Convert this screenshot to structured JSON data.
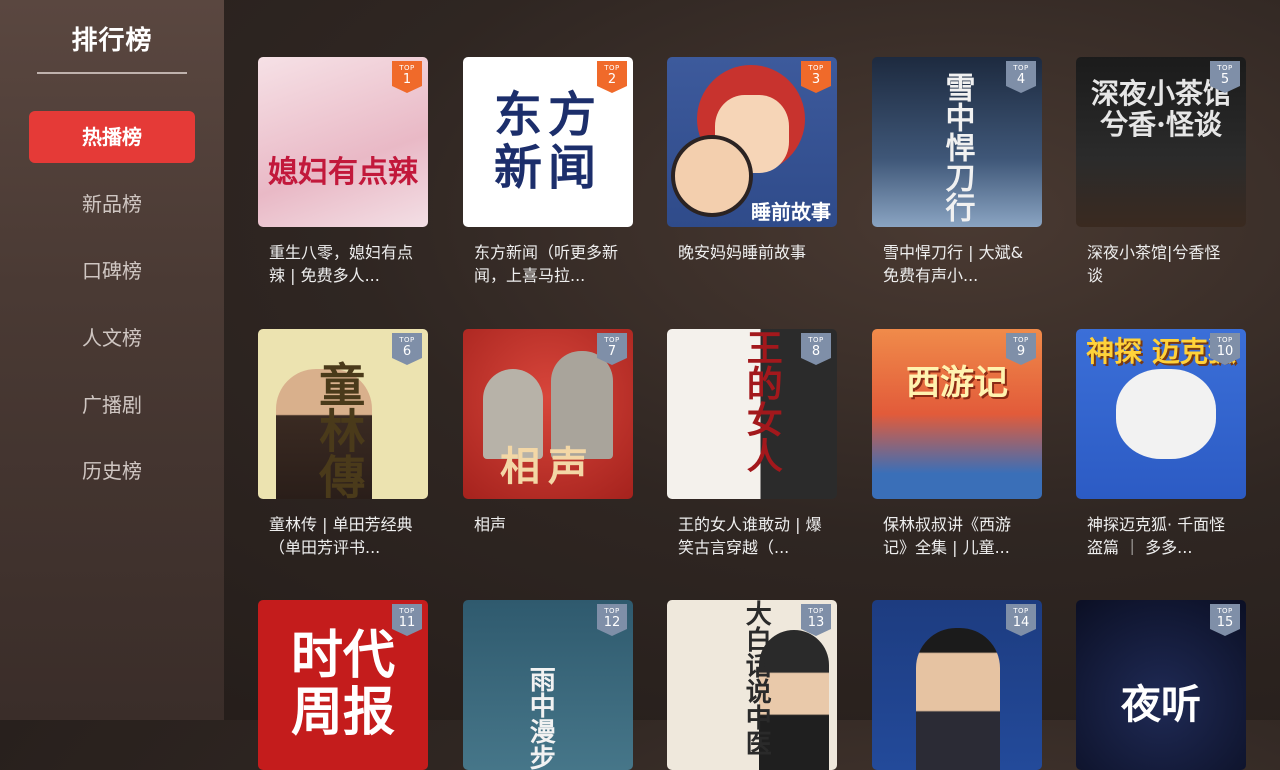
{
  "sidebar": {
    "title": "排行榜",
    "items": [
      {
        "label": "热播榜",
        "active": true
      },
      {
        "label": "新品榜",
        "active": false
      },
      {
        "label": "口碑榜",
        "active": false
      },
      {
        "label": "人文榜",
        "active": false
      },
      {
        "label": "广播剧",
        "active": false
      },
      {
        "label": "历史榜",
        "active": false
      }
    ]
  },
  "badge_label": "TOP",
  "accent_color": "#e53a37",
  "cards": [
    {
      "rank": "1",
      "title": "重生八零，媳妇有点辣 | 免费多人...",
      "cover_text": "媳妇有点辣"
    },
    {
      "rank": "2",
      "title": "东方新闻（听更多新闻，上喜马拉...",
      "cover_text": "东方新闻"
    },
    {
      "rank": "3",
      "title": "晚安妈妈睡前故事",
      "cover_text": "睡前故事"
    },
    {
      "rank": "4",
      "title": "雪中悍刀行 | 大斌&免费有声小...",
      "cover_text": "雪中悍刀行"
    },
    {
      "rank": "5",
      "title": "深夜小茶馆|兮香怪谈",
      "cover_text": "深夜小茶馆 兮香·怪谈"
    },
    {
      "rank": "6",
      "title": "童林传 | 单田芳经典（单田芳评书...",
      "cover_text": "童林傳"
    },
    {
      "rank": "7",
      "title": "相声",
      "cover_text": "相声"
    },
    {
      "rank": "8",
      "title": "王的女人谁敢动 | 爆笑古言穿越（...",
      "cover_text": "王的女人"
    },
    {
      "rank": "9",
      "title": "保林叔叔讲《西游记》全集 | 儿童...",
      "cover_text": "西游记"
    },
    {
      "rank": "10",
      "title": "神探迈克狐· 千面怪盗篇 ｜ 多多...",
      "cover_text": "神探 迈克狐"
    },
    {
      "rank": "11",
      "title": "",
      "cover_text": "时代周报"
    },
    {
      "rank": "12",
      "title": "",
      "cover_text": "雨中漫步"
    },
    {
      "rank": "13",
      "title": "",
      "cover_text": "大白话说中医"
    },
    {
      "rank": "14",
      "title": "",
      "cover_text": ""
    },
    {
      "rank": "15",
      "title": "",
      "cover_text": "夜听"
    }
  ]
}
